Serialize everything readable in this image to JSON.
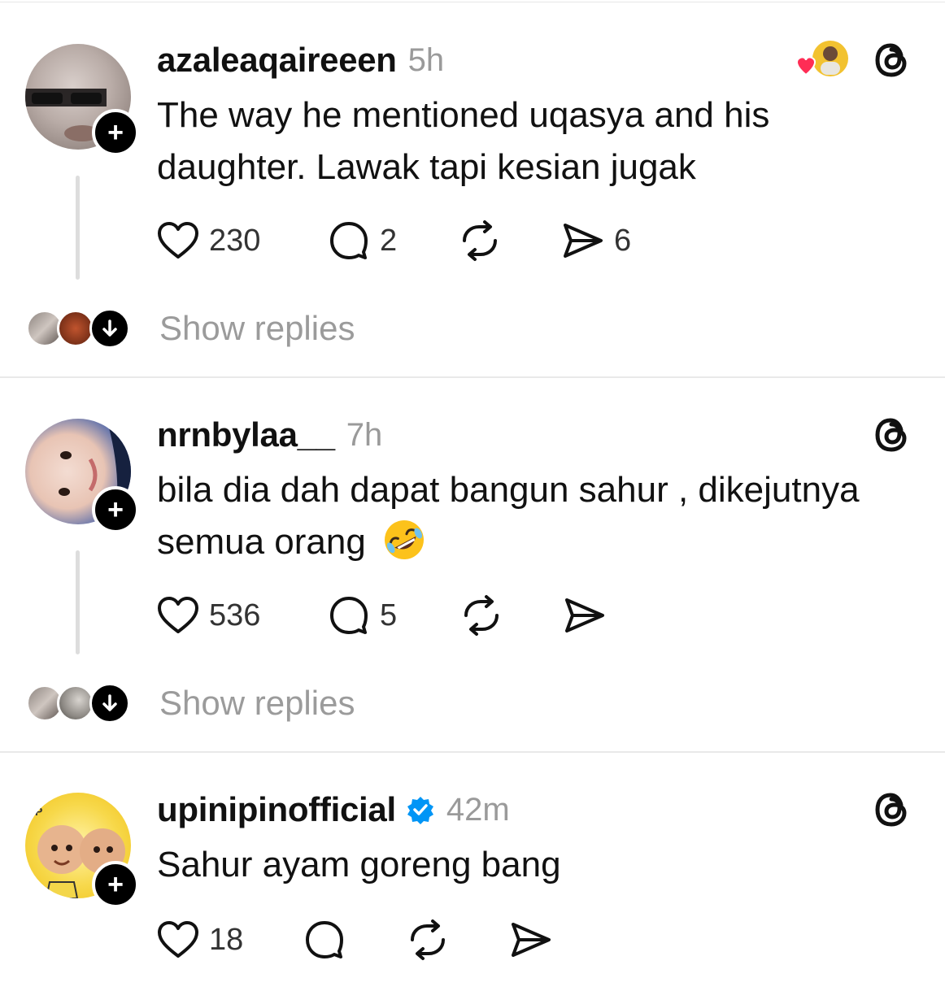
{
  "colors": {
    "text": "#111111",
    "muted": "#9a9a9a",
    "heart_red": "#ff2d55",
    "verified_blue": "#0095f6"
  },
  "posts": [
    {
      "username": "azaleaqaireeen",
      "time": "5h",
      "text_line1": "The way he mentioned uqasya and his",
      "text_line2": "daughter. Lawak tapi kesian jugak",
      "likes": "230",
      "replies": "2",
      "shares": "6",
      "show_replies": "Show replies",
      "has_liker_badge": true
    },
    {
      "username": "nrnbylaa__",
      "time": "7h",
      "text_line1": "bila dia dah dapat bangun sahur , dikejutnya",
      "text_line2": "semua orang",
      "emoji": "rofl-emoji",
      "likes": "536",
      "replies": "5",
      "show_replies": "Show replies"
    },
    {
      "username": "upinipinofficial",
      "verified": true,
      "time": "42m",
      "text_line1": "Sahur ayam goreng bang",
      "likes": "18"
    }
  ],
  "icons": {
    "like": "heart-icon",
    "reply": "comment-bubble-icon",
    "repost": "repost-icon",
    "share": "send-icon",
    "threads": "threads-logo-icon",
    "follow": "plus-icon",
    "expand": "arrow-down-icon"
  }
}
